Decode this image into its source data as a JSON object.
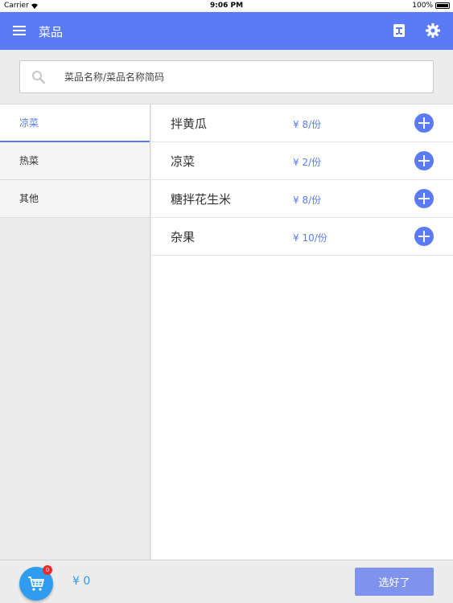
{
  "status_bar": {
    "carrier": "Carrier",
    "time": "9:06 PM",
    "battery": "100%"
  },
  "app_bar": {
    "title": "菜品",
    "icons": [
      "menu-icon",
      "table-icon",
      "gear-icon"
    ]
  },
  "search": {
    "placeholder": "菜品名称/菜品名称简码",
    "value": ""
  },
  "categories": [
    {
      "label": "凉菜",
      "active": true
    },
    {
      "label": "热菜",
      "active": false
    },
    {
      "label": "其他",
      "active": false
    }
  ],
  "dishes": [
    {
      "name": "拌黄瓜",
      "price": "¥ 8/份"
    },
    {
      "name": "凉菜",
      "price": "¥ 2/份"
    },
    {
      "name": "糖拌花生米",
      "price": "¥ 8/份"
    },
    {
      "name": "杂果",
      "price": "¥ 10/份"
    }
  ],
  "bottom_bar": {
    "cart_count": "0",
    "total": "¥ 0",
    "done_label": "选好了"
  },
  "colors": {
    "primary": "#5b7bf5",
    "cart": "#2f9cef",
    "badge": "#f02a2a",
    "done_button": "#7f93ee"
  }
}
